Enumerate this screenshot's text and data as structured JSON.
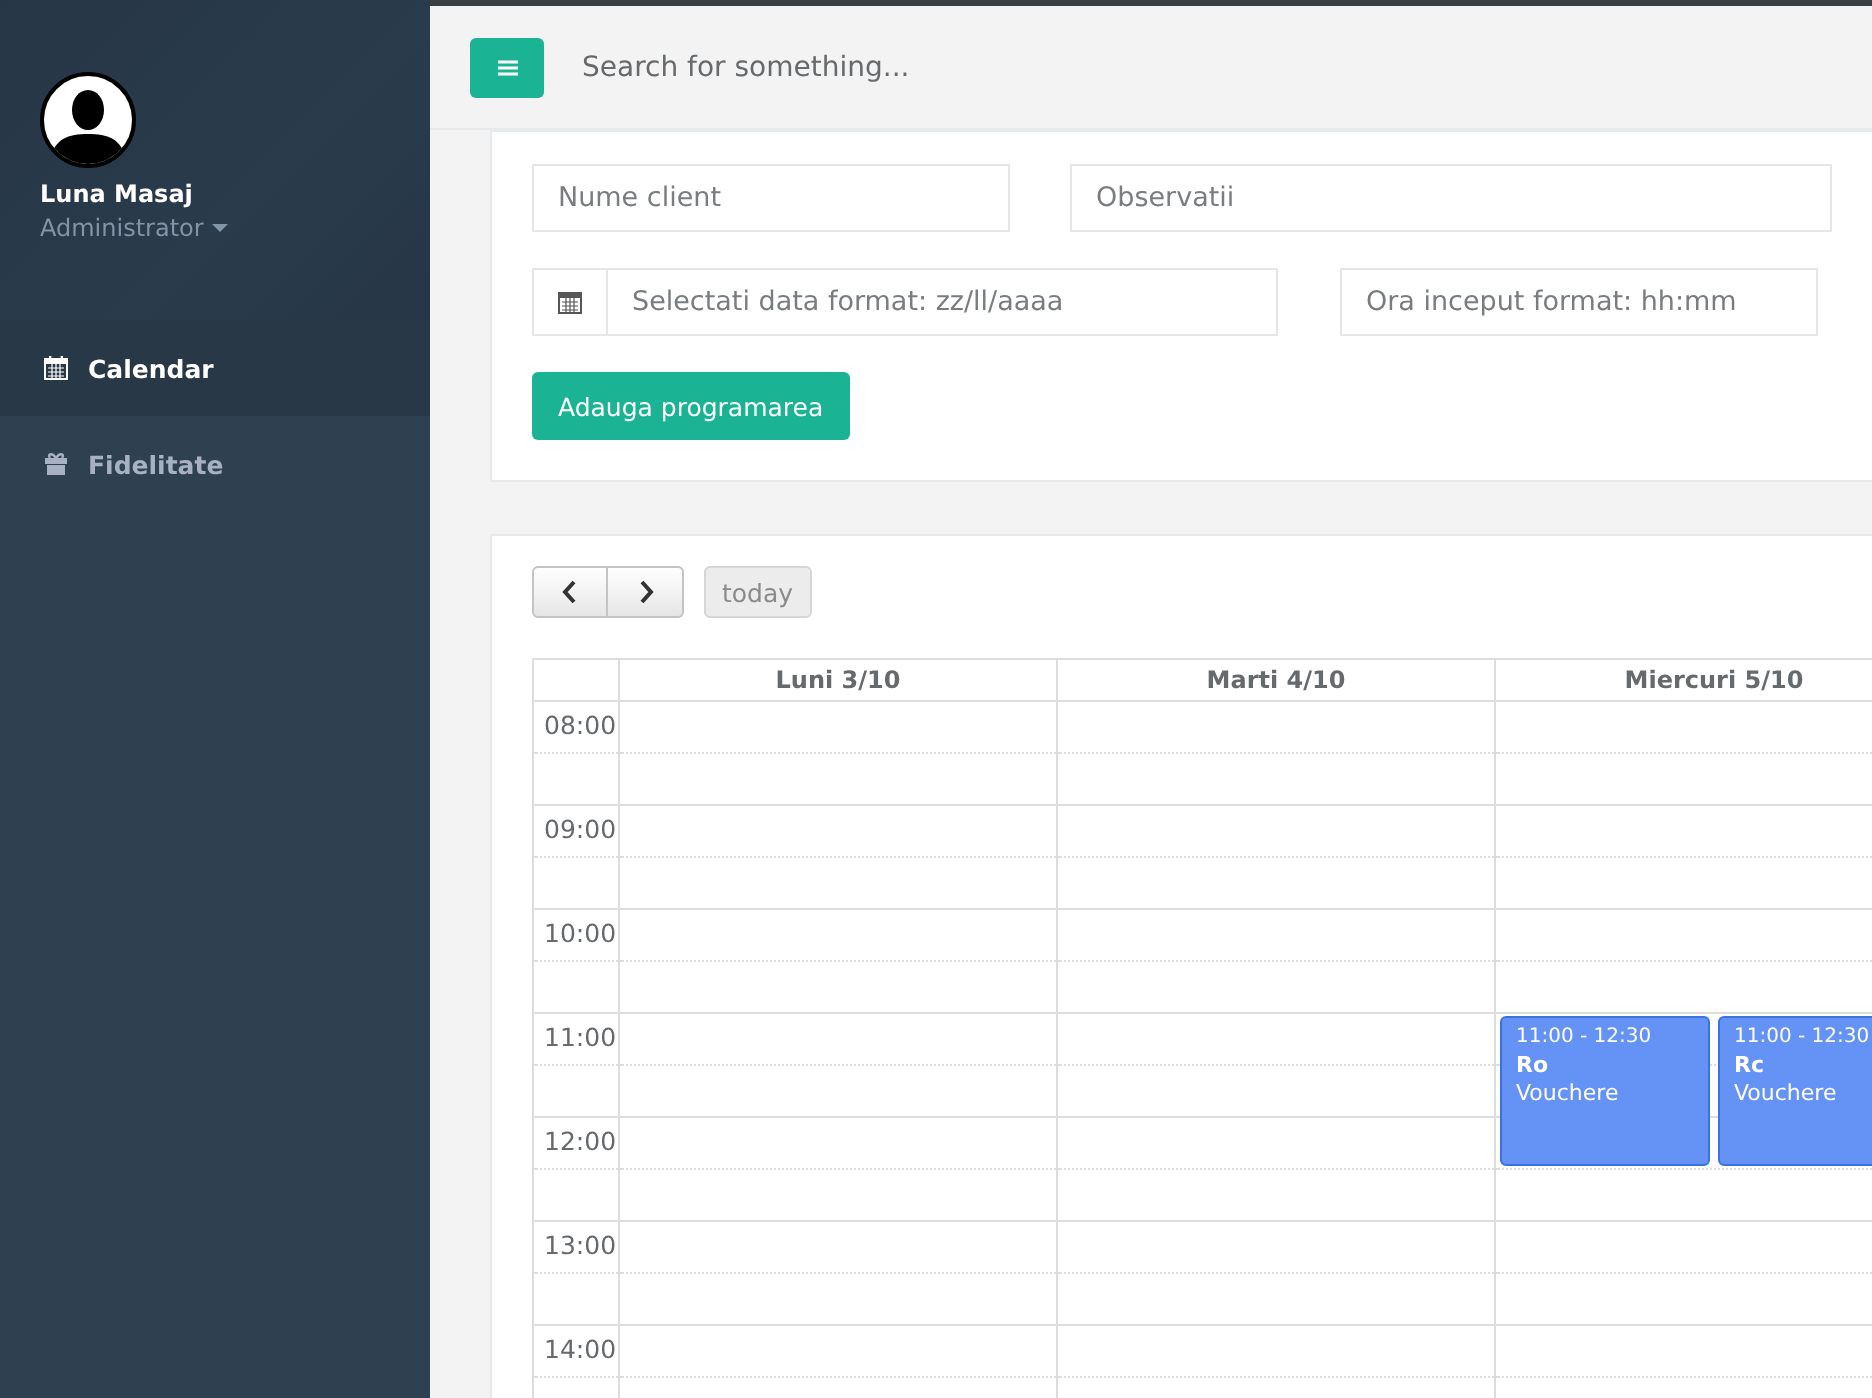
{
  "sidebar": {
    "user": {
      "name": "Luna Masaj",
      "role": "Administrator"
    },
    "items": [
      {
        "label": "Calendar",
        "selected": true
      },
      {
        "label": "Fidelitate",
        "selected": false
      }
    ]
  },
  "topbar": {
    "search": {
      "placeholder": "Search for something..."
    }
  },
  "form": {
    "client": {
      "placeholder": "Nume client"
    },
    "notes": {
      "placeholder": "Observatii"
    },
    "date": {
      "placeholder": "Selectati data format: zz/ll/aaaa"
    },
    "time": {
      "placeholder": "Ora inceput format: hh:mm"
    },
    "submit": "Adauga programarea"
  },
  "calendar": {
    "today": "today",
    "days": [
      {
        "label": "Luni 3/10"
      },
      {
        "label": "Marti 4/10"
      },
      {
        "label": "Miercuri 5/10",
        "events": [
          {
            "time": "11:00 - 12:30",
            "title": "Ro",
            "description": "Vouchere"
          },
          {
            "time": "11:00 - 12:30",
            "title": "Rc",
            "description": "Vouchere"
          }
        ]
      }
    ],
    "hours": [
      "08:00",
      "09:00",
      "10:00",
      "11:00",
      "12:00",
      "13:00",
      "14:00"
    ]
  }
}
